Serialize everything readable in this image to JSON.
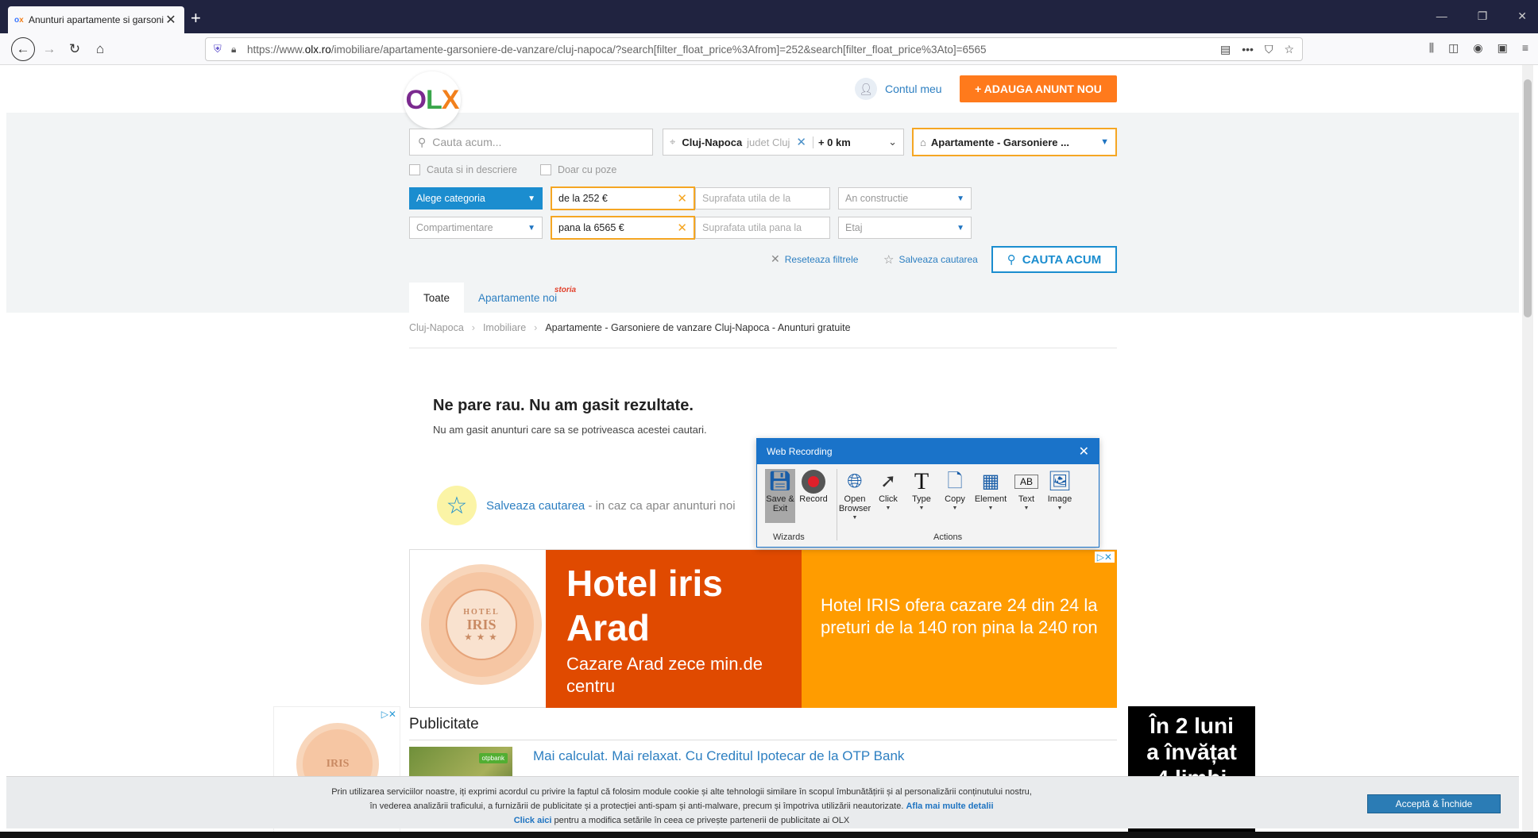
{
  "browser": {
    "tab_title": "Anunturi apartamente si garsoniere",
    "tab_favicon": "olx",
    "url_prefix": "https://www.",
    "url_host": "olx.ro",
    "url_path": "/imobiliare/apartamente-garsoniere-de-vanzare/cluj-napoca/?search[filter_float_price%3Afrom]=252&search[filter_float_price%3Ato]=6565"
  },
  "header": {
    "logo_o": "O",
    "logo_l": "L",
    "logo_x": "X",
    "account_label": "Contul meu",
    "add_button_label": "+ ADAUGA ANUNT NOU"
  },
  "search": {
    "placeholder": "Cauta acum...",
    "city": "Cluj-Napoca",
    "county": "judet Cluj",
    "radius": "+ 0 km",
    "category": "Apartamente - Garsoniere ...",
    "check_description": "Cauta si in descriere",
    "check_photos": "Doar cu poze"
  },
  "filters": {
    "category_select": "Alege categoria",
    "price_from": "de la 252 €",
    "area_from": "Suprafata utila de la",
    "year": "An constructie",
    "layout": "Compartimentare",
    "price_to": "pana la 6565 €",
    "area_to": "Suprafata utila pana la",
    "floor": "Etaj",
    "reset_label": "Reseteaza filtrele",
    "save_label": "Salveaza cautarea",
    "search_button": "CAUTA ACUM"
  },
  "tabs": {
    "all": "Toate",
    "new": "Apartamente noi",
    "new_badge": "storia"
  },
  "breadcrumb": {
    "items": [
      "Cluj-Napoca",
      "Imobiliare",
      "Apartamente - Garsoniere de vanzare Cluj-Napoca - Anunturi gratuite"
    ]
  },
  "results": {
    "title": "Ne pare rau. Nu am gasit rezultate.",
    "subtitle": "Nu am gasit anunturi care sa se potriveasca acestei cautari.",
    "save_link": "Salveaza cautarea",
    "save_rest": " - in caz ca apar anunturi noi"
  },
  "ad": {
    "seal_top": "HOTEL",
    "seal_name": "IRIS",
    "seal_stars": "★ ★ ★",
    "headline_1": "Hotel iris",
    "headline_2": "Arad",
    "sub": "Cazare Arad zece min.de centru",
    "right_text": "Hotel IRIS ofera cazare 24 din 24 la preturi de la 140 ron pina la 240 ron",
    "adchoice": "▷✕"
  },
  "side_ad": {
    "seal_name": "IRIS",
    "adchoice": "▷✕"
  },
  "publicitate": {
    "heading": "Publicitate",
    "item_title": "Mai calculat. Mai relaxat. Cu Creditul Ipotecar de la OTP Bank",
    "thumb_badge": "otpbank"
  },
  "black_ad": {
    "line1": "În 2 luni",
    "line2": "a învățat",
    "line3": "4 limbi"
  },
  "cookies": {
    "line1": "Prin utilizarea serviciilor noastre, iți exprimi acordul cu privire la faptul că folosim module cookie și alte tehnologii similare în scopul îmbunătățirii și al personalizării conținutului nostru,",
    "line2": "în vederea analizării traficului, a furnizării de publicitate și a protecției anti-spam și anti-malware, precum și împotriva utilizării neautorizate.",
    "more_link": "Afla mai multe detalii",
    "click_here": "Click aici",
    "line3": " pentru a modifica setările în ceea ce privește partenerii de publicitate ai OLX",
    "accept": "Acceptă & Închide"
  },
  "web_recording": {
    "title": "Web Recording",
    "tools": [
      {
        "label": "Save & Exit",
        "icon": "save-icon"
      },
      {
        "label": "Record",
        "icon": "record-icon"
      },
      {
        "label": "Open Browser",
        "icon": "globe-icon"
      },
      {
        "label": "Click",
        "icon": "cursor-icon"
      },
      {
        "label": "Type",
        "icon": "type-icon"
      },
      {
        "label": "Copy",
        "icon": "copy-icon"
      },
      {
        "label": "Element",
        "icon": "element-icon"
      },
      {
        "label": "Text",
        "icon": "text-icon"
      },
      {
        "label": "Image",
        "icon": "image-icon"
      }
    ],
    "group_wizards": "Wizards",
    "group_actions": "Actions"
  }
}
